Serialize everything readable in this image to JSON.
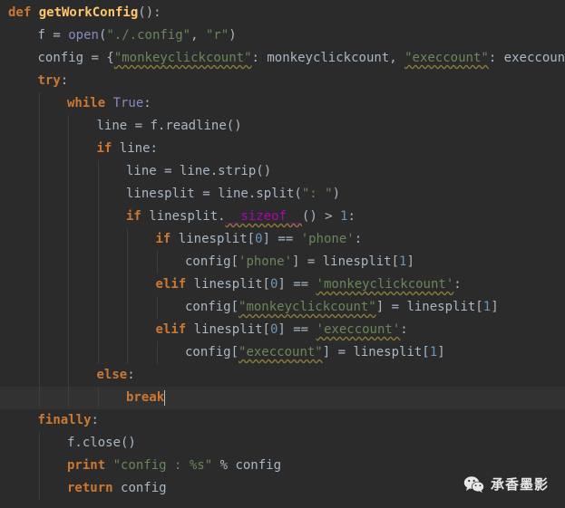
{
  "editor": {
    "theme": "darcula",
    "background": "#2b2b2b",
    "colors": {
      "keyword": "#cc7832",
      "function_name": "#ffc66d",
      "identifier": "#a9b7c6",
      "string": "#6a8759",
      "number": "#6897bb",
      "builtin": "#8888c6",
      "magic_method": "#b200b2"
    },
    "caret_line": 17,
    "lines": [
      {
        "indent": 0,
        "tokens": [
          {
            "t": "kw",
            "v": "def "
          },
          {
            "t": "fn",
            "v": "getWorkConfig"
          },
          {
            "t": "punc",
            "v": "():"
          }
        ]
      },
      {
        "indent": 1,
        "tokens": [
          {
            "t": "id",
            "v": "f = "
          },
          {
            "t": "builtin",
            "v": "open"
          },
          {
            "t": "punc",
            "v": "("
          },
          {
            "t": "str",
            "v": "\"./.config\""
          },
          {
            "t": "punc",
            "v": ", "
          },
          {
            "t": "str",
            "v": "\"r\""
          },
          {
            "t": "punc",
            "v": ")"
          }
        ]
      },
      {
        "indent": 1,
        "tokens": [
          {
            "t": "id",
            "v": "config = {"
          },
          {
            "t": "str",
            "v": "\"monkeyclickcount\"",
            "sq": true
          },
          {
            "t": "punc",
            "v": ": monkeyclickcount, "
          },
          {
            "t": "str",
            "v": "\"execcount\"",
            "sq": true
          },
          {
            "t": "punc",
            "v": ": execcount}"
          }
        ]
      },
      {
        "indent": 1,
        "tokens": [
          {
            "t": "kw",
            "v": "try"
          },
          {
            "t": "punc",
            "v": ":"
          }
        ]
      },
      {
        "indent": 2,
        "tokens": [
          {
            "t": "kw",
            "v": "while "
          },
          {
            "t": "builtin",
            "v": "True"
          },
          {
            "t": "punc",
            "v": ":"
          }
        ]
      },
      {
        "indent": 3,
        "tokens": [
          {
            "t": "id",
            "v": "line = f.readline()"
          }
        ]
      },
      {
        "indent": 3,
        "tokens": [
          {
            "t": "kw",
            "v": "if "
          },
          {
            "t": "id",
            "v": "line:"
          }
        ]
      },
      {
        "indent": 4,
        "tokens": [
          {
            "t": "id",
            "v": "line = line.strip()"
          }
        ]
      },
      {
        "indent": 4,
        "tokens": [
          {
            "t": "id",
            "v": "linesplit = line.split("
          },
          {
            "t": "str",
            "v": "\": \""
          },
          {
            "t": "punc",
            "v": ")"
          }
        ]
      },
      {
        "indent": 4,
        "tokens": [
          {
            "t": "kw",
            "v": "if "
          },
          {
            "t": "id",
            "v": "linesplit."
          },
          {
            "t": "magic",
            "v": "__sizeof__",
            "sq": true
          },
          {
            "t": "punc",
            "v": "() > "
          },
          {
            "t": "num",
            "v": "1"
          },
          {
            "t": "punc",
            "v": ":"
          }
        ]
      },
      {
        "indent": 5,
        "tokens": [
          {
            "t": "kw",
            "v": "if "
          },
          {
            "t": "id",
            "v": "linesplit["
          },
          {
            "t": "num",
            "v": "0"
          },
          {
            "t": "punc",
            "v": "] == "
          },
          {
            "t": "str",
            "v": "'phone'"
          },
          {
            "t": "punc",
            "v": ":"
          }
        ]
      },
      {
        "indent": 6,
        "tokens": [
          {
            "t": "id",
            "v": "config["
          },
          {
            "t": "str",
            "v": "'phone'"
          },
          {
            "t": "punc",
            "v": "] = linesplit["
          },
          {
            "t": "num",
            "v": "1"
          },
          {
            "t": "punc",
            "v": "]"
          }
        ]
      },
      {
        "indent": 5,
        "tokens": [
          {
            "t": "kw",
            "v": "elif "
          },
          {
            "t": "id",
            "v": "linesplit["
          },
          {
            "t": "num",
            "v": "0"
          },
          {
            "t": "punc",
            "v": "] == "
          },
          {
            "t": "str",
            "v": "'monkeyclickcount'",
            "sq": true
          },
          {
            "t": "punc",
            "v": ":"
          }
        ]
      },
      {
        "indent": 6,
        "tokens": [
          {
            "t": "id",
            "v": "config["
          },
          {
            "t": "str",
            "v": "\"monkeyclickcount\"",
            "sq": true
          },
          {
            "t": "punc",
            "v": "] = linesplit["
          },
          {
            "t": "num",
            "v": "1"
          },
          {
            "t": "punc",
            "v": "]"
          }
        ]
      },
      {
        "indent": 5,
        "tokens": [
          {
            "t": "kw",
            "v": "elif "
          },
          {
            "t": "id",
            "v": "linesplit["
          },
          {
            "t": "num",
            "v": "0"
          },
          {
            "t": "punc",
            "v": "] == "
          },
          {
            "t": "str",
            "v": "'execcount'",
            "sq": true
          },
          {
            "t": "punc",
            "v": ":"
          }
        ]
      },
      {
        "indent": 6,
        "tokens": [
          {
            "t": "id",
            "v": "config["
          },
          {
            "t": "str",
            "v": "\"execcount\"",
            "sq": true
          },
          {
            "t": "punc",
            "v": "] = linesplit["
          },
          {
            "t": "num",
            "v": "1"
          },
          {
            "t": "punc",
            "v": "]"
          }
        ]
      },
      {
        "indent": 3,
        "tokens": [
          {
            "t": "kw",
            "v": "else"
          },
          {
            "t": "punc",
            "v": ":"
          }
        ]
      },
      {
        "indent": 4,
        "tokens": [
          {
            "t": "kw",
            "v": "break"
          }
        ]
      },
      {
        "indent": 1,
        "tokens": [
          {
            "t": "kw",
            "v": "finally"
          },
          {
            "t": "punc",
            "v": ":"
          }
        ]
      },
      {
        "indent": 2,
        "tokens": [
          {
            "t": "id",
            "v": "f.close()"
          }
        ]
      },
      {
        "indent": 2,
        "tokens": [
          {
            "t": "kw",
            "v": "print "
          },
          {
            "t": "str",
            "v": "\"config : %s\""
          },
          {
            "t": "punc",
            "v": " % config"
          }
        ]
      },
      {
        "indent": 2,
        "tokens": [
          {
            "t": "kw",
            "v": "return "
          },
          {
            "t": "id",
            "v": "config"
          }
        ]
      }
    ]
  },
  "watermark": {
    "icon": "wechat-icon",
    "label": "承香墨影"
  }
}
